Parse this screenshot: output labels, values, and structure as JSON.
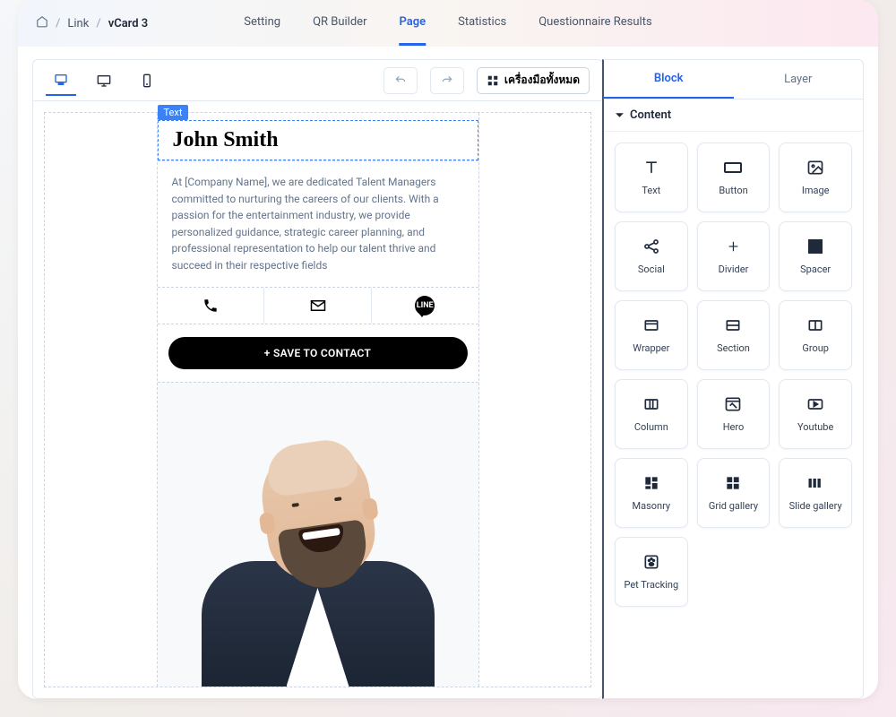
{
  "breadcrumb": {
    "link": "Link",
    "current": "vCard 3"
  },
  "nav": {
    "setting": "Setting",
    "qr": "QR Builder",
    "page": "Page",
    "stats": "Statistics",
    "quest": "Questionnaire Results"
  },
  "toolbar": {
    "all_tools": "เครื่องมือทั้งหมด"
  },
  "card": {
    "tag": "Text",
    "name": "John Smith",
    "desc": "At [Company Name], we are dedicated Talent Managers committed to nurturing the careers of our clients. With a passion for the entertainment industry, we provide personalized guidance, strategic career planning, and professional representation to help our talent thrive and succeed in their respective fields",
    "save": "+ SAVE TO CONTACT",
    "line_label": "LINE"
  },
  "side": {
    "tabs": {
      "block": "Block",
      "layer": "Layer"
    },
    "section": "Content",
    "blocks": {
      "text": "Text",
      "button": "Button",
      "image": "Image",
      "social": "Social",
      "divider": "Divider",
      "spacer": "Spacer",
      "wrapper": "Wrapper",
      "section_b": "Section",
      "group": "Group",
      "column": "Column",
      "hero": "Hero",
      "youtube": "Youtube",
      "masonry": "Masonry",
      "grid": "Grid gallery",
      "slide": "Slide gallery",
      "pet": "Pet Tracking"
    }
  }
}
